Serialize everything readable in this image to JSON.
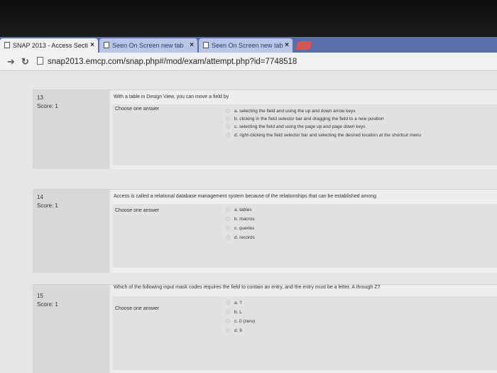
{
  "tabs": [
    {
      "label": "SNAP 2013 - Access Secti",
      "close": "×"
    },
    {
      "label": "Seen On Screen new tab",
      "close": "×"
    },
    {
      "label": "Seen On Screen new tab",
      "close": "×"
    }
  ],
  "address_bar": {
    "url": "snap2013.emcp.com/snap.php#/mod/exam/attempt.php?id=7748518"
  },
  "questions": [
    {
      "number": "13",
      "score": "Score: 1",
      "text": "With a table in Design View, you can move a field by",
      "choose": "Choose one answer",
      "answers": [
        "a. selecting the field and using the up and down arrow keys",
        "b. clicking in the field selector bar and dragging the field to a new position",
        "c. selecting the field and using the page up and page down keys",
        "d. right-clicking the field selector bar and selecting the desired location at the shortcut menu"
      ]
    },
    {
      "number": "14",
      "score": "Score: 1",
      "text": "Access is called a relational database management system because of the relationships that can be established among",
      "choose": "Choose one answer",
      "answers": [
        "a. tables",
        "b. macros",
        "c. queries",
        "d. records"
      ]
    },
    {
      "number": "15",
      "score": "Score: 1",
      "text": "Which of the following input mask codes requires the field to contain an entry, and the entry must be a letter, A through Z?",
      "choose": "Choose one answer",
      "answers": [
        "a. ?",
        "b. L",
        "c. 0 (zero)",
        "d. 9"
      ]
    }
  ]
}
